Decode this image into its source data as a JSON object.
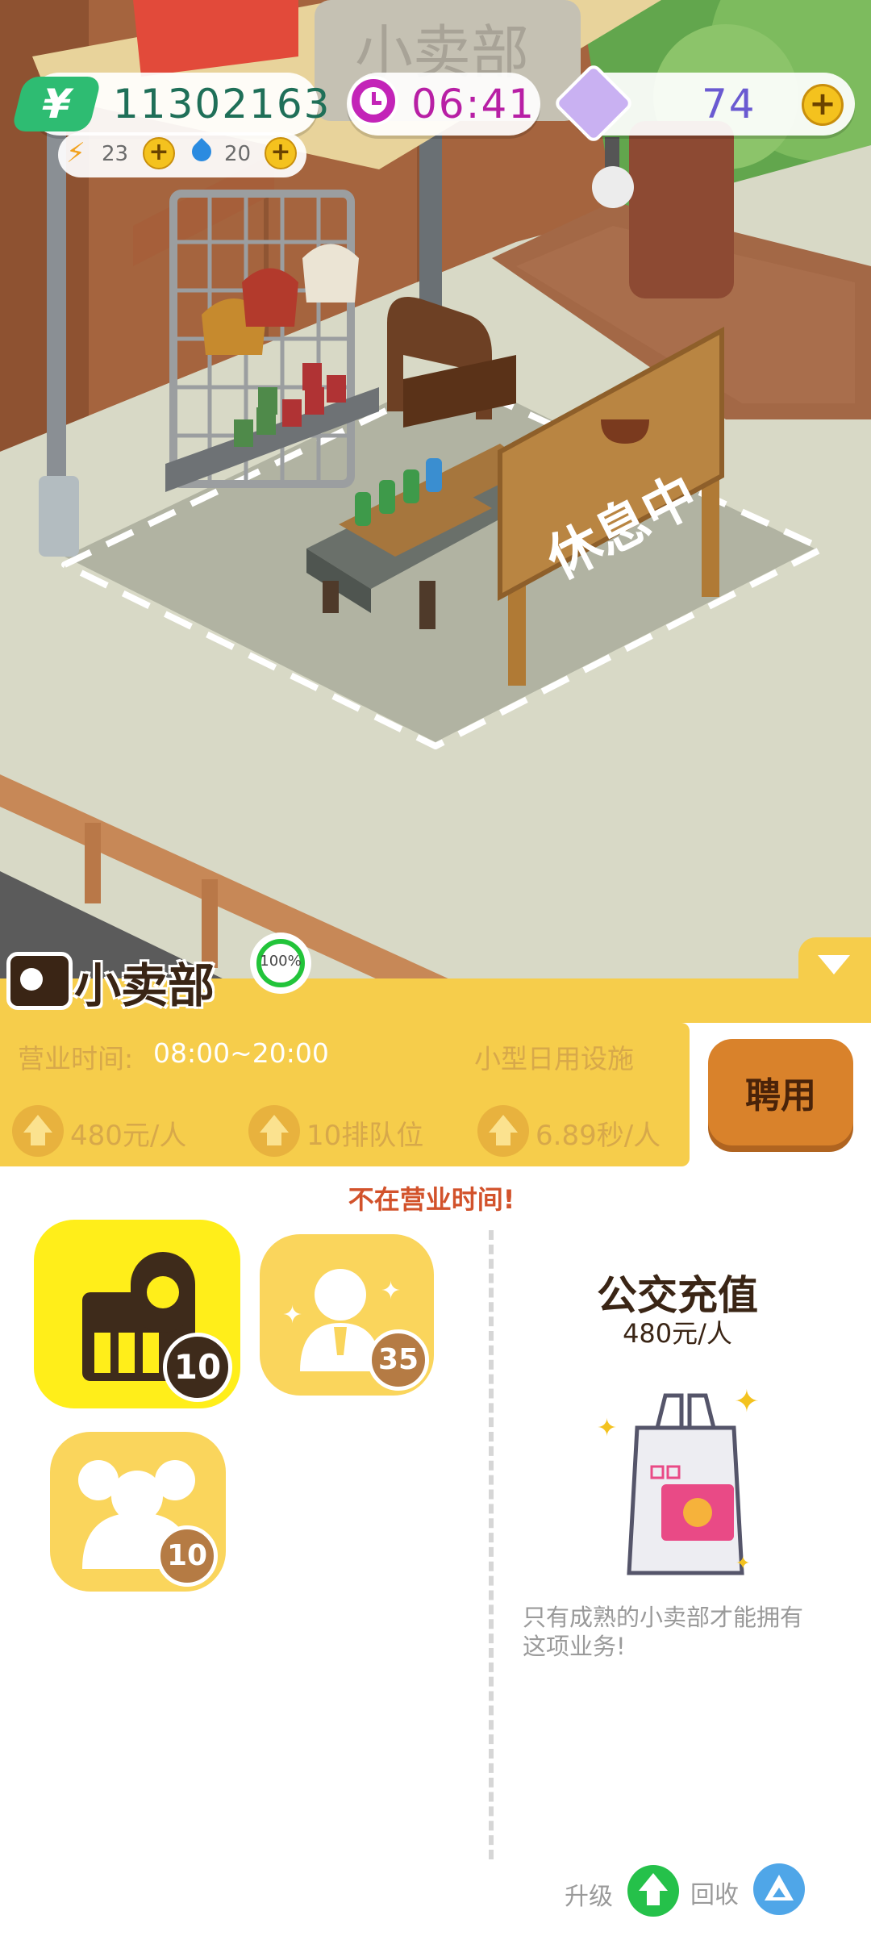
{
  "hud": {
    "cash": "11302163",
    "cash_icon": "yuan-icon",
    "clock": "06:41",
    "gems": "74",
    "energy": "23",
    "water": "20"
  },
  "scene": {
    "stall_sign": "小卖部",
    "rest_sign": "休息中"
  },
  "panel": {
    "title": "小卖部",
    "progress": "100%",
    "progress_value": 1.0,
    "hours_label": "营业时间:",
    "hours_value": "08:00~20:00",
    "category": "小型日用设施",
    "stats": [
      "480元/人",
      "10排队位",
      "6.89秒/人"
    ],
    "hire_button": "聘用",
    "status_notice": "不在营业时间!",
    "tiles": [
      {
        "badge": "10"
      },
      {
        "badge": "35"
      },
      {
        "badge": "10"
      }
    ],
    "service_title": "公交充值",
    "service_price": "480元/人",
    "service_note_1": "只有成熟的小卖部才能拥有",
    "service_note_2": "这项业务!",
    "upgrade_label": "升级",
    "recycle_label": "回收"
  },
  "colors": {
    "panel_yellow": "#f6cd4b",
    "tile_yellow": "#fad55c",
    "tile_selected": "#ffee1a",
    "hire_orange": "#d9822b",
    "notice_red": "#d2522b",
    "progress_green": "#22c43a",
    "upgrade_green": "#25c14a",
    "recycle_blue": "#4fa6e8"
  }
}
